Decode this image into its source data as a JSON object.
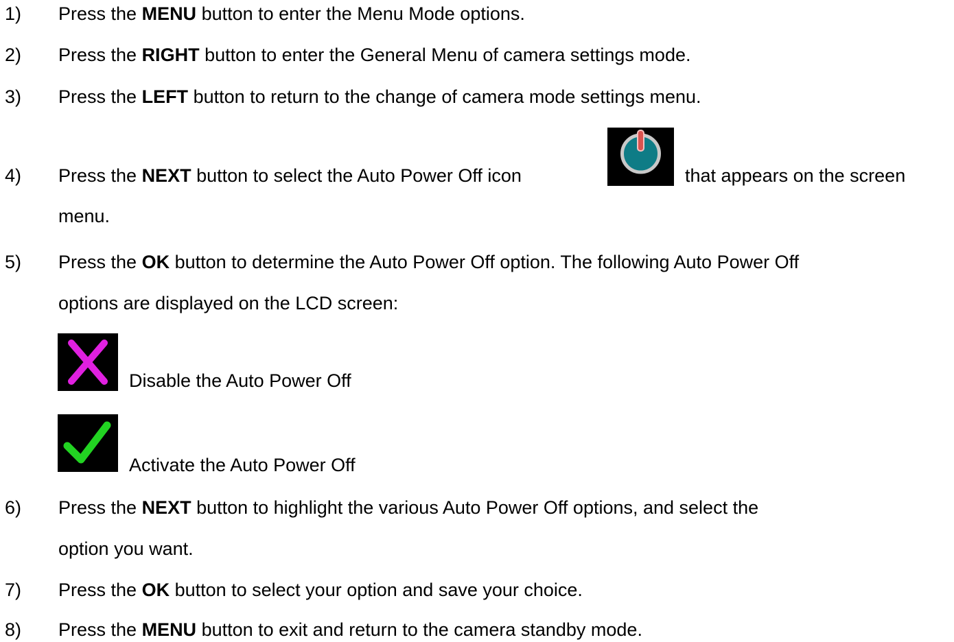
{
  "steps": [
    {
      "num": "1)",
      "pre": "Press the ",
      "key": "MENU",
      "post": " button to enter the Menu Mode options."
    },
    {
      "num": "2)",
      "pre": "Press the ",
      "key": "RIGHT",
      "post": " button to enter the General Menu of camera settings mode."
    },
    {
      "num": "3)",
      "pre": "Press the ",
      "key": "LEFT",
      "post": " button to return to the change of camera mode settings menu."
    },
    {
      "num": "4)",
      "pre": "Press the ",
      "key": "NEXT",
      "post": " button to select the Auto Power Off icon",
      "post2": " that appears on the screen",
      "cont": "menu."
    },
    {
      "num": "5)",
      "pre": "Press the ",
      "key": "OK",
      "post": " button to determine the Auto Power Off option. The following Auto Power Off",
      "cont": "options are displayed on the LCD screen:"
    },
    {
      "num": "6)",
      "pre": "Press the ",
      "key": "NEXT",
      "post": " button to highlight the various Auto Power Off options, and select the",
      "cont": "option you want."
    },
    {
      "num": "7)",
      "pre": "Press the ",
      "key": "OK",
      "post": " button to select your option and save your choice."
    },
    {
      "num": "8)",
      "pre": "Press the ",
      "key": "MENU",
      "post": " button to exit and return to the camera standby mode."
    }
  ],
  "options": [
    {
      "icon": "x-disable-icon",
      "label": "Disable the Auto Power Off"
    },
    {
      "icon": "checkmark-activate-icon",
      "label": "Activate the Auto Power Off"
    }
  ],
  "colors": {
    "power_icon_ring": "#0e7c86",
    "power_icon_stroke": "#d9534f",
    "disable_x": "#e020e0",
    "activate_check": "#22d322"
  }
}
